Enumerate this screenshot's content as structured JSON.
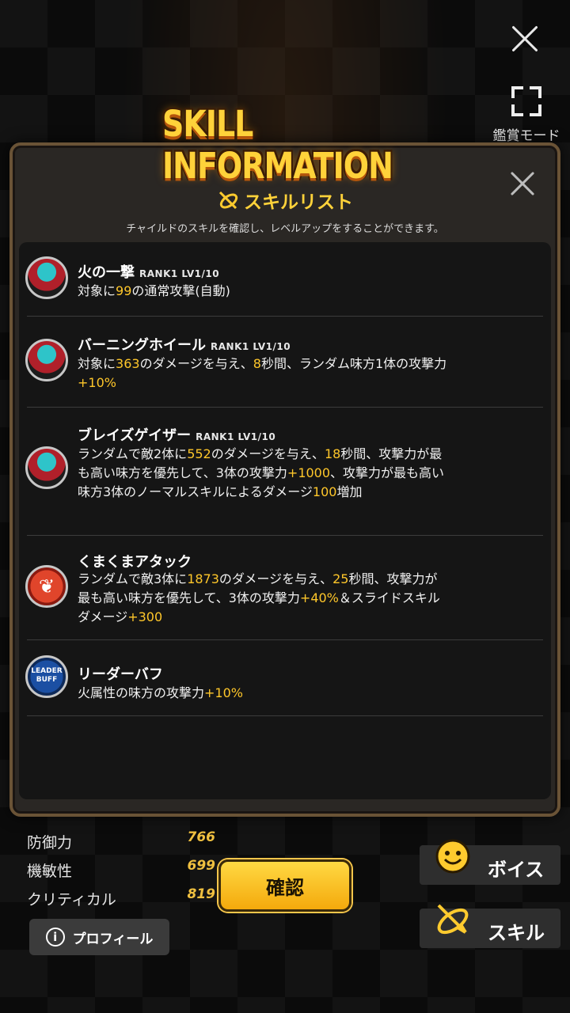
{
  "top": {
    "view_mode_label": "鑑賞モード"
  },
  "panel": {
    "banner_title": "SKILL INFORMATION",
    "list_title": "スキルリスト",
    "list_subtitle": "チャイルドのスキルを確認し、レベルアップをすることができます。"
  },
  "skills": [
    {
      "name": "火の一撃",
      "rank": "RANK1 LV1/10",
      "desc": [
        [
          "対象に",
          ""
        ],
        [
          "99",
          "hl"
        ],
        [
          "の通常攻撃(自動)",
          ""
        ]
      ]
    },
    {
      "name": "バーニングホイール",
      "rank": "RANK1 LV1/10",
      "desc": [
        [
          "対象に",
          ""
        ],
        [
          "363",
          "hl"
        ],
        [
          "のダメージを与え、",
          ""
        ],
        [
          "8",
          "hl"
        ],
        [
          "秒間、ランダム味方1体の攻撃力",
          ""
        ],
        [
          "+10%",
          "hl"
        ]
      ]
    },
    {
      "name": "ブレイズゲイザー",
      "rank": "RANK1 LV1/10",
      "desc": [
        [
          "ランダムで敵2体に",
          ""
        ],
        [
          "552",
          "hl"
        ],
        [
          "のダメージを与え、",
          ""
        ],
        [
          "18",
          "hl"
        ],
        [
          "秒間、攻撃力が最も高い味方を優先して、3体の攻撃力",
          ""
        ],
        [
          "+1000",
          "hl"
        ],
        [
          "、攻撃力が最も高い味方3体のノーマルスキルによるダメージ",
          ""
        ],
        [
          "100",
          "hl"
        ],
        [
          "増加",
          ""
        ]
      ]
    },
    {
      "name": "くまくまアタック",
      "rank": "",
      "desc": [
        [
          "ランダムで敵3体に",
          ""
        ],
        [
          "1873",
          "hl"
        ],
        [
          "のダメージを与え、",
          ""
        ],
        [
          "25",
          "hl"
        ],
        [
          "秒間、攻撃力が最も高い味方を優先して、3体の攻撃力",
          ""
        ],
        [
          "+40%",
          "hl"
        ],
        [
          "＆スライドスキルダメージ",
          ""
        ],
        [
          "+300",
          "hl"
        ]
      ]
    },
    {
      "name": "リーダーバフ",
      "rank": "",
      "desc": [
        [
          "火属性の味方の攻撃力",
          ""
        ],
        [
          "+10%",
          "hl"
        ]
      ]
    }
  ],
  "icons": {
    "skill_icons": [
      "character-portrait-icon",
      "character-portrait-icon",
      "slide-skill-portrait-icon",
      "wing-emblem-icon",
      "leader-buff-icon"
    ],
    "leader_icon_text": "LEADER BUFF"
  },
  "stats": [
    {
      "label": "防御力",
      "value": "766"
    },
    {
      "label": "機敏性",
      "value": "699"
    },
    {
      "label": "クリティカル",
      "value": "819"
    }
  ],
  "buttons": {
    "profile": "プロフィール",
    "confirm": "確認",
    "voice": "ボイス",
    "skill": "スキル"
  },
  "colors": {
    "accent_yellow": "#ffc72a",
    "panel_border": "#6a5336",
    "confirm_button": "#ffd943"
  }
}
